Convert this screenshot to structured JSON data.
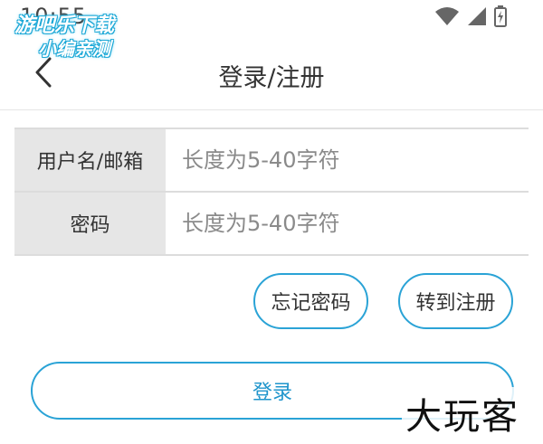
{
  "status_bar": {
    "time": "10:55"
  },
  "watermark_top": {
    "line1": "游吧乐下载",
    "line2": "小编亲测"
  },
  "header": {
    "title": "登录/注册"
  },
  "form": {
    "username": {
      "label": "用户名/邮箱",
      "placeholder": "长度为5-40字符",
      "value": ""
    },
    "password": {
      "label": "密码",
      "placeholder": "长度为5-40字符",
      "value": ""
    }
  },
  "buttons": {
    "forgot_password": "忘记密码",
    "go_register": "转到注册",
    "login": "登录"
  },
  "watermark_bottom": {
    "text": "大玩客"
  },
  "colors": {
    "accent": "#2aa3d6",
    "label_bg": "#e6e6e6",
    "divider": "#dcdcdc"
  },
  "icons": {
    "back": "chevron-left-icon",
    "wifi": "wifi-icon",
    "signal": "signal-icon",
    "battery": "battery-icon"
  }
}
